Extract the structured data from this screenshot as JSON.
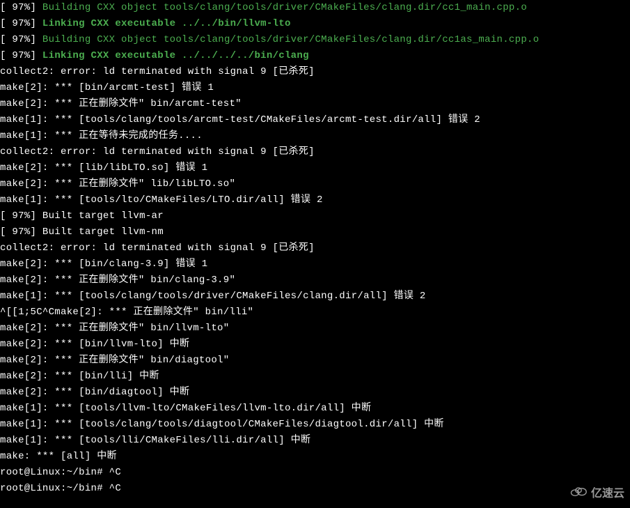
{
  "lines": [
    {
      "segments": [
        {
          "text": "[ 97%] ",
          "class": "white"
        },
        {
          "text": "Building CXX object tools/clang/tools/driver/CMakeFiles/clang.dir/cc1_main.cpp.o",
          "class": "green"
        }
      ]
    },
    {
      "segments": [
        {
          "text": "[ 97%] ",
          "class": "white"
        },
        {
          "text": "Linking CXX executable ../../bin/llvm-lto",
          "class": "green-bold"
        }
      ]
    },
    {
      "segments": [
        {
          "text": "[ 97%] ",
          "class": "white"
        },
        {
          "text": "Building CXX object tools/clang/tools/driver/CMakeFiles/clang.dir/cc1as_main.cpp.o",
          "class": "green"
        }
      ]
    },
    {
      "segments": [
        {
          "text": "[ 97%] ",
          "class": "white"
        },
        {
          "text": "Linking CXX executable ../../../../bin/clang",
          "class": "green-bold"
        }
      ]
    },
    {
      "segments": [
        {
          "text": "collect2: error: ld terminated with signal 9 [已杀死]",
          "class": "white"
        }
      ]
    },
    {
      "segments": [
        {
          "text": "make[2]: *** [bin/arcmt-test] 错误 1",
          "class": "white"
        }
      ]
    },
    {
      "segments": [
        {
          "text": "make[2]: *** 正在删除文件\" bin/arcmt-test\"",
          "class": "white"
        }
      ]
    },
    {
      "segments": [
        {
          "text": "make[1]: *** [tools/clang/tools/arcmt-test/CMakeFiles/arcmt-test.dir/all] 错误 2",
          "class": "white"
        }
      ]
    },
    {
      "segments": [
        {
          "text": "make[1]: *** 正在等待未完成的任务....",
          "class": "white"
        }
      ]
    },
    {
      "segments": [
        {
          "text": "collect2: error: ld terminated with signal 9 [已杀死]",
          "class": "white"
        }
      ]
    },
    {
      "segments": [
        {
          "text": "make[2]: *** [lib/libLTO.so] 错误 1",
          "class": "white"
        }
      ]
    },
    {
      "segments": [
        {
          "text": "make[2]: *** 正在删除文件\" lib/libLTO.so\"",
          "class": "white"
        }
      ]
    },
    {
      "segments": [
        {
          "text": "make[1]: *** [tools/lto/CMakeFiles/LTO.dir/all] 错误 2",
          "class": "white"
        }
      ]
    },
    {
      "segments": [
        {
          "text": "[ 97%] Built target llvm-ar",
          "class": "white"
        }
      ]
    },
    {
      "segments": [
        {
          "text": "[ 97%] Built target llvm-nm",
          "class": "white"
        }
      ]
    },
    {
      "segments": [
        {
          "text": "collect2: error: ld terminated with signal 9 [已杀死]",
          "class": "white"
        }
      ]
    },
    {
      "segments": [
        {
          "text": "make[2]: *** [bin/clang-3.9] 错误 1",
          "class": "white"
        }
      ]
    },
    {
      "segments": [
        {
          "text": "make[2]: *** 正在删除文件\" bin/clang-3.9\"",
          "class": "white"
        }
      ]
    },
    {
      "segments": [
        {
          "text": "make[1]: *** [tools/clang/tools/driver/CMakeFiles/clang.dir/all] 错误 2",
          "class": "white"
        }
      ]
    },
    {
      "segments": [
        {
          "text": "^[[1;5C^Cmake[2]: *** 正在删除文件\" bin/lli\"",
          "class": "white"
        }
      ]
    },
    {
      "segments": [
        {
          "text": "make[2]: *** 正在删除文件\" bin/llvm-lto\"",
          "class": "white"
        }
      ]
    },
    {
      "segments": [
        {
          "text": "make[2]: *** [bin/llvm-lto] 中断",
          "class": "white"
        }
      ]
    },
    {
      "segments": [
        {
          "text": "make[2]: *** 正在删除文件\" bin/diagtool\"",
          "class": "white"
        }
      ]
    },
    {
      "segments": [
        {
          "text": "make[2]: *** [bin/lli] 中断",
          "class": "white"
        }
      ]
    },
    {
      "segments": [
        {
          "text": "make[2]: *** [bin/diagtool] 中断",
          "class": "white"
        }
      ]
    },
    {
      "segments": [
        {
          "text": "make[1]: *** [tools/llvm-lto/CMakeFiles/llvm-lto.dir/all] 中断",
          "class": "white"
        }
      ]
    },
    {
      "segments": [
        {
          "text": "make[1]: *** [tools/clang/tools/diagtool/CMakeFiles/diagtool.dir/all] 中断",
          "class": "white"
        }
      ]
    },
    {
      "segments": [
        {
          "text": "make[1]: *** [tools/lli/CMakeFiles/lli.dir/all] 中断",
          "class": "white"
        }
      ]
    },
    {
      "segments": [
        {
          "text": "make: *** [all] 中断",
          "class": "white"
        }
      ]
    },
    {
      "segments": [
        {
          "text": "",
          "class": "white"
        }
      ]
    },
    {
      "segments": [
        {
          "text": "root@Linux:~/bin# ^C",
          "class": "white"
        }
      ]
    },
    {
      "segments": [
        {
          "text": "root@Linux:~/bin# ^C",
          "class": "white"
        }
      ]
    }
  ],
  "watermark": {
    "text": "亿速云"
  }
}
